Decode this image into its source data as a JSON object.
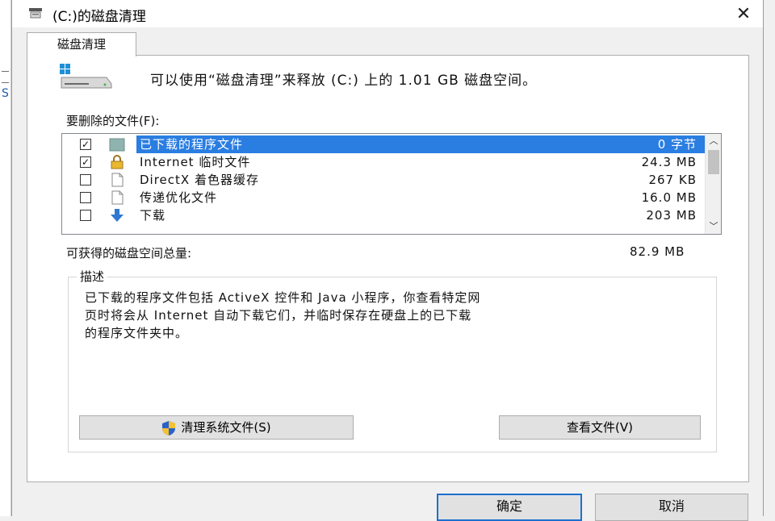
{
  "window": {
    "title": "(C:)的磁盘清理",
    "close_glyph": "✕"
  },
  "tab": {
    "label": "磁盘清理"
  },
  "header": {
    "text": "可以使用“磁盘清理”来释放 (C:) 上的 1.01 GB 磁盘空间。"
  },
  "files_label": "要删除的文件(F):",
  "file_list": {
    "items": [
      {
        "name": "已下载的程序文件",
        "size": "0 字节",
        "checked": true,
        "selected": true,
        "icon": "folder-icon"
      },
      {
        "name": "Internet 临时文件",
        "size": "24.3 MB",
        "checked": true,
        "selected": false,
        "icon": "lock-icon"
      },
      {
        "name": "DirectX 着色器缓存",
        "size": "267 KB",
        "checked": false,
        "selected": false,
        "icon": "document-icon"
      },
      {
        "name": "传递优化文件",
        "size": "16.0 MB",
        "checked": false,
        "selected": false,
        "icon": "document-icon"
      },
      {
        "name": "下载",
        "size": "203 MB",
        "checked": false,
        "selected": false,
        "icon": "download-arrow-icon"
      }
    ]
  },
  "total": {
    "label": "可获得的磁盘空间总量:",
    "value": "82.9 MB"
  },
  "description": {
    "legend": "描述",
    "text": "已下载的程序文件包括 ActiveX 控件和 Java 小程序，你查看特定网\n页时将会从 Internet 自动下载它们，并临时保存在硬盘上的已下载\n的程序文件夹中。"
  },
  "buttons": {
    "clean_system": "清理系统文件(S)",
    "view_files": "查看文件(V)",
    "ok": "确定",
    "cancel": "取消"
  },
  "colors": {
    "selection": "#2a7de1",
    "focus_border": "#1d6fcf"
  }
}
